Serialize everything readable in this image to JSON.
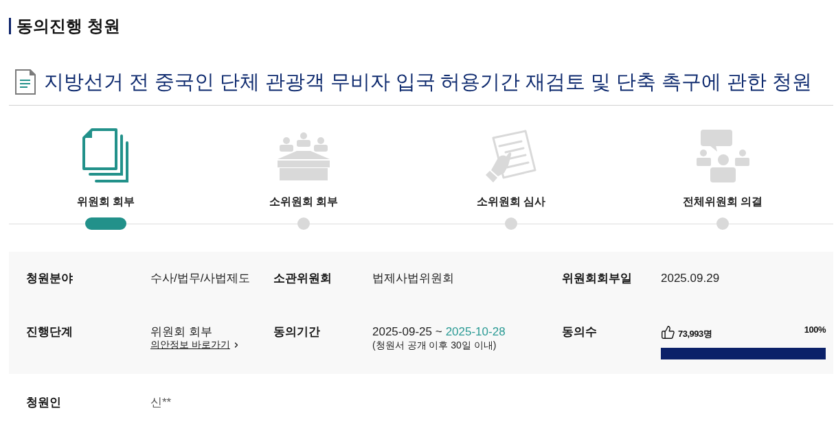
{
  "section_title": "동의진행 청원",
  "petition_title": "지방선거 전 중국인 단체 관광객 무비자 입국 허용기간 재검토 및 단축 촉구에 관한 청원",
  "steps": [
    {
      "label": "위원회 회부",
      "selected": true
    },
    {
      "label": "소위원회 회부",
      "selected": false
    },
    {
      "label": "소위원회 심사",
      "selected": false
    },
    {
      "label": "전체위원회 의결",
      "selected": false
    }
  ],
  "details": [
    {
      "kind": "text",
      "label": "청원분야",
      "value": "수사/법무/사법제도"
    },
    {
      "kind": "text",
      "label": "소관위원회",
      "value": "법제사법위원회"
    },
    {
      "kind": "text",
      "label": "위원회회부일",
      "value": "2025.09.29"
    },
    {
      "kind": "link",
      "label": "진행단계",
      "value": "위원회 회부",
      "link": "의안정보 바로가기"
    },
    {
      "kind": "period",
      "label": "동의기간",
      "start": "2025-09-25 ~",
      "end": "2025-10-28",
      "note": "(청원서 공개 이후 30일 이내)"
    },
    {
      "kind": "votes",
      "label": "동의수",
      "count": "73,993명",
      "percent": "100%",
      "level": 1
    }
  ],
  "petitioner": {
    "label": "청원인",
    "value": "신**"
  }
}
